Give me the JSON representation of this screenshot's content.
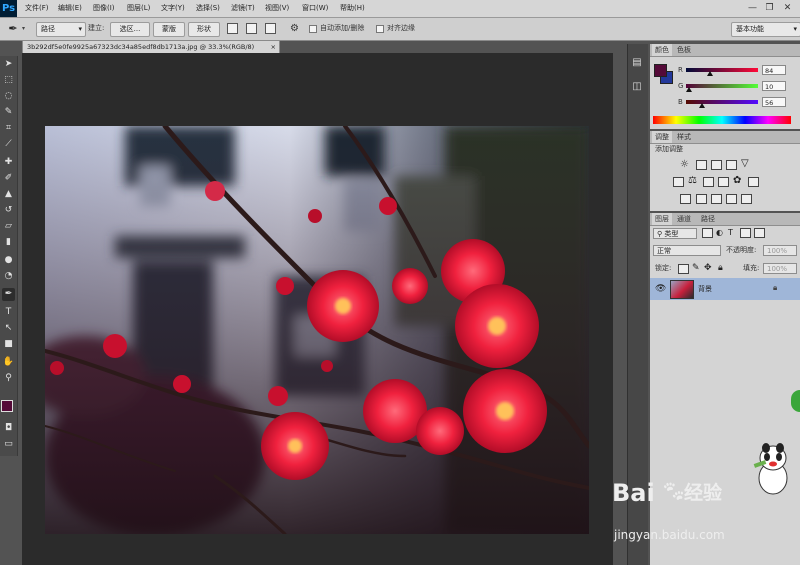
{
  "app": {
    "logo": "Ps"
  },
  "menu": [
    "文件(F)",
    "编辑(E)",
    "图像(I)",
    "图层(L)",
    "文字(Y)",
    "选择(S)",
    "滤镜(T)",
    "视图(V)",
    "窗口(W)",
    "帮助(H)"
  ],
  "window_controls": {
    "minimize": "—",
    "restore": "❐",
    "close": "✕"
  },
  "options_bar": {
    "mode_value": "路径",
    "build_label": "建立:",
    "selection_button": "选区...",
    "mask_button": "蒙版",
    "shape_button": "形状",
    "auto_add_delete": "自动添加/删除",
    "align_edges": "对齐边缘",
    "workspace": "基本功能"
  },
  "document": {
    "tab_title": "3b292df5e0fe9925a67323dc34a85edf8db1713a.jpg @ 33.3%(RGB/8)",
    "tab_close": "×"
  },
  "color_panel": {
    "tabs": [
      "颜色",
      "色板"
    ],
    "channels": [
      {
        "label": "R",
        "value": "84",
        "fraction": 0.33
      },
      {
        "label": "G",
        "value": "10",
        "fraction": 0.04
      },
      {
        "label": "B",
        "value": "56",
        "fraction": 0.22
      }
    ],
    "foreground_color": "#540a38",
    "background_color": "#23389a"
  },
  "adjust_panel": {
    "tabs": [
      "调整",
      "样式"
    ],
    "title": "添加调整"
  },
  "layers_panel": {
    "tabs": [
      "图层",
      "通道",
      "路径"
    ],
    "filter_kind": "类型",
    "blend_mode": "正常",
    "opacity_label": "不透明度:",
    "opacity_value": "100%",
    "lock_label": "锁定:",
    "fill_label": "填充:",
    "fill_value": "100%",
    "layer_name": "背景"
  },
  "watermark": {
    "brand": "Bai",
    "brand_suffix": "经验",
    "url": "jingyan.baidu.com"
  },
  "colors": {
    "accent_selected_layer": "#9fb6d8",
    "ui_dark": "#535353",
    "panel_light": "#d4d4d4"
  }
}
